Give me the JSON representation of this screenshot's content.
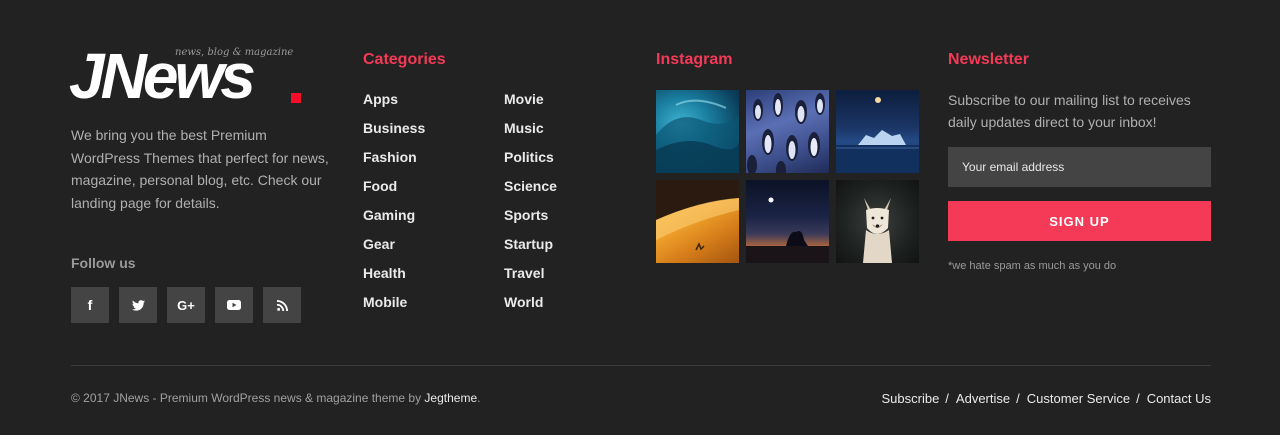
{
  "about": {
    "logo_text": "JNews",
    "logo_tagline": "news, blog & magazine",
    "description": "We bring you the best Premium WordPress Themes that perfect for news, magazine, personal blog, etc. Check our landing page for details.",
    "follow_label": "Follow us",
    "socials": [
      {
        "icon": "facebook-icon",
        "glyph": "f"
      },
      {
        "icon": "twitter-icon",
        "glyph": ""
      },
      {
        "icon": "google-plus-icon",
        "glyph": "G+"
      },
      {
        "icon": "youtube-icon",
        "glyph": ""
      },
      {
        "icon": "rss-icon",
        "glyph": ""
      }
    ]
  },
  "categories": {
    "title": "Categories",
    "col1": [
      "Apps",
      "Business",
      "Fashion",
      "Food",
      "Gaming",
      "Gear",
      "Health",
      "Mobile"
    ],
    "col2": [
      "Movie",
      "Music",
      "Politics",
      "Science",
      "Sports",
      "Startup",
      "Travel",
      "World"
    ]
  },
  "instagram": {
    "title": "Instagram"
  },
  "newsletter": {
    "title": "Newsletter",
    "description": "Subscribe to our mailing list to receives daily updates direct to your inbox!",
    "email_placeholder": "Your email address",
    "button_label": "SIGN UP",
    "note": "*we hate spam as much as you do"
  },
  "bottom": {
    "copyright_prefix": "© 2017 JNews - Premium WordPress news & magazine theme by ",
    "copyright_link": "Jegtheme",
    "copyright_suffix": ".",
    "links": [
      "Subscribe",
      "Advertise",
      "Customer Service",
      "Contact Us"
    ],
    "separator": "/"
  },
  "colors": {
    "background": "#222222",
    "accent": "#f43a57",
    "button_bg": "#444444"
  }
}
